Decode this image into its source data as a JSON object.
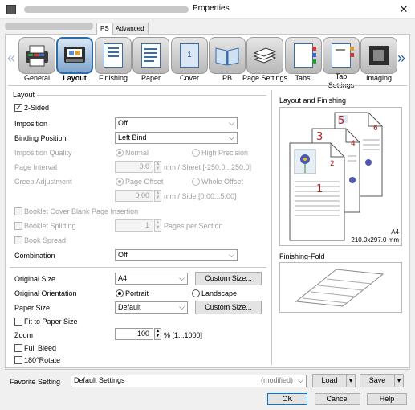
{
  "window": {
    "title": "Properties",
    "close_glyph": "✕"
  },
  "tabs": [
    {
      "label": "PS"
    },
    {
      "label": "Advanced"
    }
  ],
  "toolbar": {
    "prev_glyph": "«",
    "next_glyph": "»",
    "items": [
      {
        "label": "General",
        "icon": "printer-icon"
      },
      {
        "label": "Layout",
        "icon": "layout-icon",
        "active": true
      },
      {
        "label": "Finishing",
        "icon": "finishing-icon"
      },
      {
        "label": "Paper",
        "icon": "paper-icon"
      },
      {
        "label": "Cover",
        "icon": "cover-icon"
      },
      {
        "label": "PB",
        "icon": "perfect-bind-icon"
      },
      {
        "label": "Page Settings",
        "icon": "page-settings-icon"
      },
      {
        "label": "Tabs",
        "icon": "tabs-icon"
      },
      {
        "label": "Tab\nSettings",
        "icon": "tab-settings-icon"
      },
      {
        "label": "Imaging",
        "icon": "imaging-icon"
      }
    ]
  },
  "layout": {
    "section_title": "Layout",
    "two_sided": {
      "label": "2-Sided",
      "checked": true
    },
    "imposition": {
      "label": "Imposition",
      "value": "Off"
    },
    "binding_position": {
      "label": "Binding Position",
      "value": "Left Bind"
    },
    "imposition_quality": {
      "label": "Imposition Quality",
      "option_normal": "Normal",
      "option_high": "High Precision",
      "selected": "Normal"
    },
    "page_interval": {
      "label": "Page Interval",
      "value": "0.0",
      "unit": "mm / Sheet [-250.0...250.0]"
    },
    "creep_adjustment": {
      "label": "Creep Adjustment",
      "option_page_offset": "Page Offset",
      "option_whole_offset": "Whole Offset",
      "selected": "Page Offset",
      "value": "0.00",
      "unit": "mm / Side [0.00...5.00]"
    },
    "booklet_cover": {
      "label": "Booklet Cover Blank Page Insertion"
    },
    "booklet_splitting": {
      "label": "Booklet Splitting",
      "value": "1",
      "unit": "Pages per Section"
    },
    "book_spread": {
      "label": "Book Spread"
    },
    "combination": {
      "label": "Combination",
      "value": "Off"
    }
  },
  "original": {
    "size": {
      "label": "Original Size",
      "value": "A4",
      "button": "Custom Size..."
    },
    "orientation": {
      "label": "Original Orientation",
      "option_portrait": "Portrait",
      "option_landscape": "Landscape",
      "selected": "Portrait"
    },
    "paper_size": {
      "label": "Paper Size",
      "value": "Default",
      "button": "Custom Size..."
    },
    "fit_to_paper": {
      "label": "Fit to Paper Size",
      "checked": false
    },
    "zoom": {
      "label": "Zoom",
      "value": "100",
      "unit": "% [1...1000]"
    },
    "full_bleed": {
      "label": "Full Bleed",
      "checked": false
    },
    "rotate_180": {
      "label": "180°Rotate",
      "checked": false
    }
  },
  "preview": {
    "title": "Layout and Finishing",
    "page_numbers": [
      "5",
      "6",
      "3",
      "4",
      "1",
      "2"
    ],
    "paper_name": "A4",
    "paper_dims": "210.0x297.0 mm",
    "fold_title": "Finishing-Fold"
  },
  "favorite": {
    "label": "Favorite Setting",
    "value": "Default Settings",
    "status": "(modified)",
    "load": "Load",
    "save": "Save"
  },
  "footer": {
    "ok": "OK",
    "cancel": "Cancel",
    "help": "Help"
  },
  "colors": {
    "accent": "#2f6aa8",
    "page_number": "#b02020",
    "flower": "#5058b0"
  }
}
